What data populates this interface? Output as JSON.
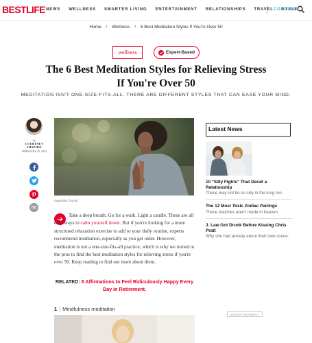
{
  "header": {
    "logo_best": "BEST",
    "logo_life": "LIFE",
    "nav": [
      "NEWS",
      "WELLNESS",
      "SMARTER LIVING",
      "ENTERTAINMENT",
      "RELATIONSHIPS",
      "TRAVEL",
      "STYLE"
    ],
    "coronal": "CORONAL",
    "search_icon": "search-icon"
  },
  "breadcrumb": {
    "home": "Home",
    "section": "Wellness",
    "current": "6 Best Meditation Styles If You're Over 50",
    "separator": "/"
  },
  "tags": {
    "category": "wellness",
    "expert": "Expert-Based"
  },
  "article": {
    "title": "The 6 Best Meditation Styles for Relieving Stress If You're Over 50",
    "subtitle": "MEDITATION ISN'T ONE-SIZE-FITS-ALL. THERE ARE DIFFERENT STYLES THAT CAN EASE YOUR MIND.",
    "author_by": "by",
    "author_name": "COURTNEY SHAPIRO",
    "author_date": "FEBRUARY 25, 2024",
    "image_credit": "mapodile / iStock",
    "body_1": "Take a deep breath. Go for a walk. Light a candle. These are all easy ways to ",
    "body_link": "calm yourself down",
    "body_2": ". But if you're looking for a more structured relaxation exercise to add to your daily routine, experts recommend meditation, especially as you get older. However, meditation is not a one-size-fits-all practice, which is why we turned to the pros to find the best meditation styles for relieving stress if you're over 50. Keep reading to find out more about them.",
    "related_label": "RELATED:",
    "related_link": "8 Affirmations to Feel Ridiculously Happy Every Day in Retirement",
    "related_period": ".",
    "section_num": "1",
    "section_bar": "|",
    "section_title": "Mindfulness meditation"
  },
  "sidebar": {
    "latest_title": "Latest News",
    "items": [
      {
        "title": "10 \"Silly Fights\" That Derail a Relationship",
        "dek": "These may not be so silly in the long run."
      },
      {
        "title": "The 12 Most Toxic Zodiac Pairings",
        "dek": "These matches aren't made in heaven."
      },
      {
        "title": "J. Law Got Drunk Before Kissing Chris Pratt",
        "dek": "Why she had anxiety about their love scene."
      }
    ],
    "ad_label": "ADVERTISEMENT"
  },
  "colors": {
    "brand_red": "#e4002b",
    "coronal_blue": "#3aa8d8",
    "facebook": "#3b5998",
    "twitter": "#1da1f2",
    "pinterest": "#e60023"
  }
}
